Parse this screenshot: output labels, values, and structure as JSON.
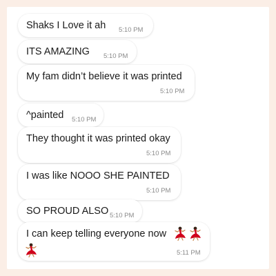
{
  "conversation": {
    "messages": [
      {
        "text": "Shaks I Love it ah",
        "time": "5:10 PM"
      },
      {
        "text": "ITS AMAZING",
        "time": "5:10 PM"
      },
      {
        "text": "My fam didn’t believe it was printed",
        "time": "5:10 PM"
      },
      {
        "text": "^painted",
        "time": "5:10 PM"
      },
      {
        "text": "They thought it was printed okay",
        "time": "5:10 PM"
      },
      {
        "text": "I was like NOOO SHE PAINTED",
        "time": "5:10 PM"
      },
      {
        "text": "SO PROUD ALSO",
        "time": "5:10 PM"
      },
      {
        "text": "I can keep telling everyone now",
        "time": "5:11 PM",
        "emoji": [
          "dancer-icon",
          "dancer-icon",
          "dancer-icon"
        ]
      }
    ]
  },
  "colors": {
    "page_background": "#fbeee6",
    "bubble_background": "#ffffff",
    "text": "#1a1a1a",
    "timestamp": "#8a8a8a",
    "emoji_red": "#d0021b"
  }
}
